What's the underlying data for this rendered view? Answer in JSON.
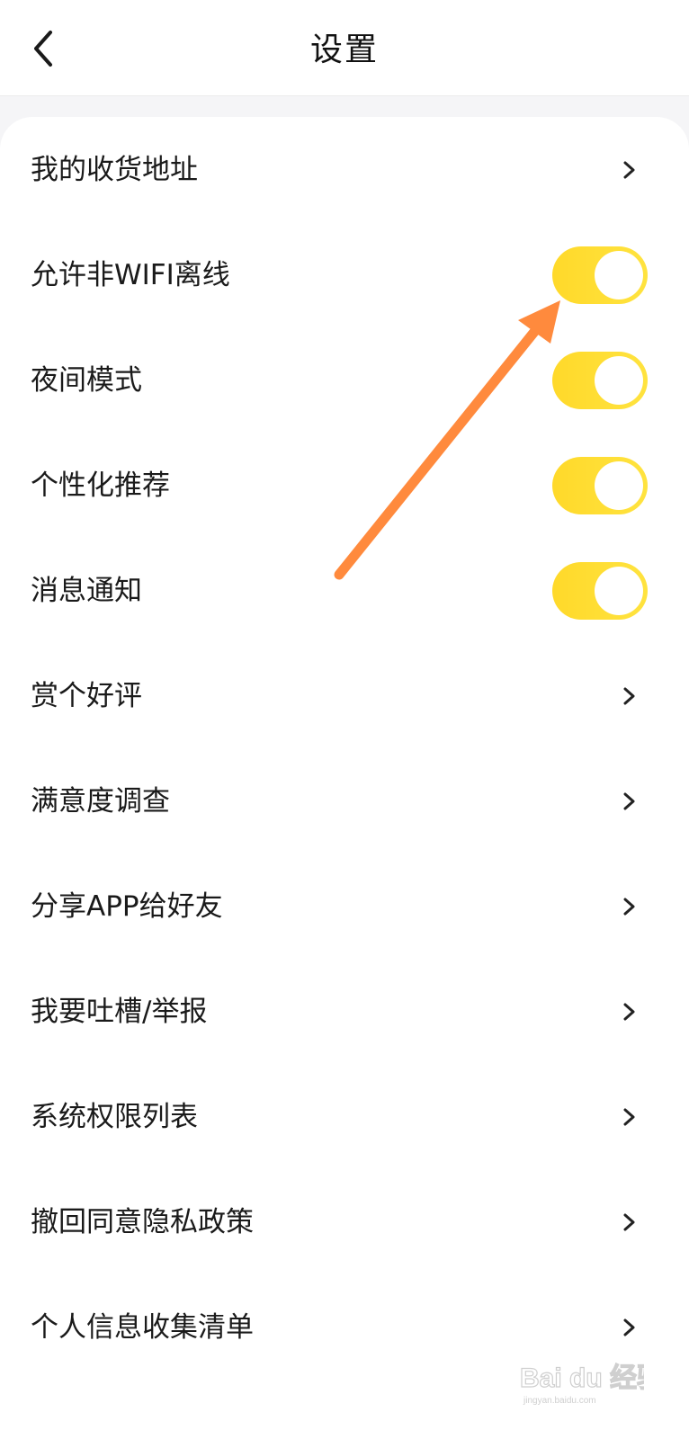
{
  "header": {
    "title": "设置",
    "back_icon": "chevron-left-icon"
  },
  "colors": {
    "toggle_on": "#ffe33f",
    "toggle_on_edge": "#ffd92a",
    "annotation_arrow": "#ff8a3d",
    "text": "#1a1a1a",
    "chevron": "#222222"
  },
  "settings": [
    {
      "label": "我的收货地址",
      "control": "chevron"
    },
    {
      "label": "允许非WIFI离线",
      "control": "toggle",
      "on": true
    },
    {
      "label": "夜间模式",
      "control": "toggle",
      "on": true
    },
    {
      "label": "个性化推荐",
      "control": "toggle",
      "on": true
    },
    {
      "label": "消息通知",
      "control": "toggle",
      "on": true
    },
    {
      "label": "赏个好评",
      "control": "chevron"
    },
    {
      "label": "满意度调查",
      "control": "chevron"
    },
    {
      "label": "分享APP给好友",
      "control": "chevron"
    },
    {
      "label": "我要吐槽/举报",
      "control": "chevron"
    },
    {
      "label": "系统权限列表",
      "control": "chevron"
    },
    {
      "label": "撤回同意隐私政策",
      "control": "chevron"
    },
    {
      "label": "个人信息收集清单",
      "control": "chevron"
    }
  ],
  "watermark": {
    "brand": "Bai du 经验",
    "sub": "jingyan.baidu.com"
  }
}
